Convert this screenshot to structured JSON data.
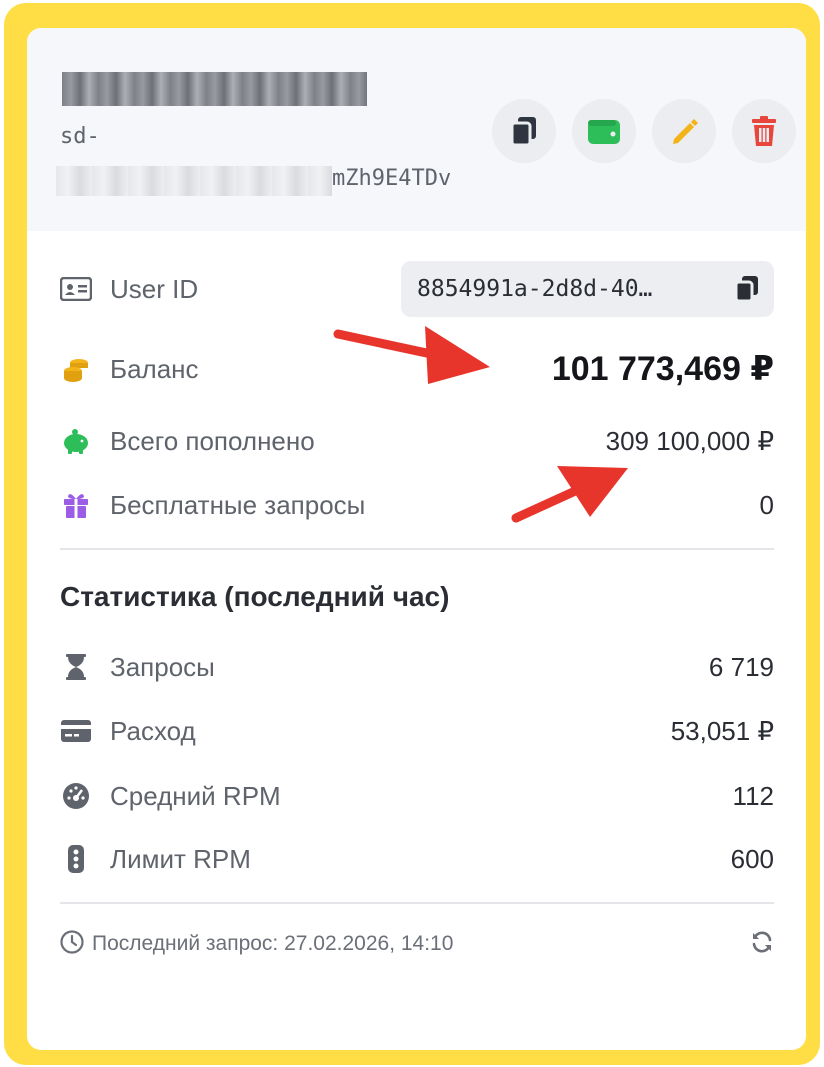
{
  "api_key": {
    "prefix": "sd-",
    "suffix": "mZh9E4TDv"
  },
  "actions": [
    {
      "icon": "copy-icon",
      "color": "#2F3540"
    },
    {
      "icon": "wallet-icon",
      "color": "#2DBE5A"
    },
    {
      "icon": "pencil-icon",
      "color": "#F2B418"
    },
    {
      "icon": "trash-icon",
      "color": "#E8453C"
    }
  ],
  "info": {
    "user_id_label": "User ID",
    "user_id_value": "8854991a-2d8d-40…",
    "balance_label": "Баланс",
    "balance_value": "101 773,469 ₽",
    "topped_up_label": "Всего пополнено",
    "topped_up_value": "309 100,000 ₽",
    "free_requests_label": "Бесплатные запросы",
    "free_requests_value": "0"
  },
  "stats": {
    "title": "Статистика (последний час)",
    "requests_label": "Запросы",
    "requests_value": "6 719",
    "spend_label": "Расход",
    "spend_value": "53,051 ₽",
    "avg_rpm_label": "Средний RPM",
    "avg_rpm_value": "112",
    "rpm_limit_label": "Лимит RPM",
    "rpm_limit_value": "600"
  },
  "footer": {
    "last_request": "Последний запрос: 27.02.2026, 14:10"
  },
  "colors": {
    "frame": "#FFDE45",
    "annotation_arrow": "#E8352B",
    "header_bg": "#F5F7FA"
  }
}
